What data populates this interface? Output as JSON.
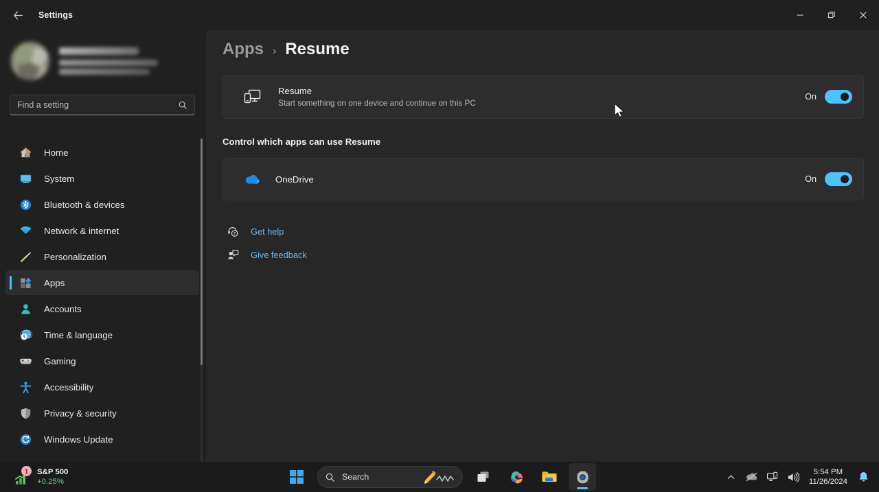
{
  "window": {
    "title": "Settings",
    "back_icon": "back-arrow-icon",
    "controls": {
      "minimize": "minimize-icon",
      "restore": "restore-icon",
      "close": "close-icon"
    }
  },
  "sidebar": {
    "account": {
      "name_redacted": "",
      "email_redacted": ""
    },
    "search": {
      "placeholder": "Find a setting",
      "value": "",
      "icon": "search-icon"
    },
    "items": [
      {
        "label": "Home",
        "icon": "home-icon",
        "active": false
      },
      {
        "label": "System",
        "icon": "system-icon",
        "active": false
      },
      {
        "label": "Bluetooth & devices",
        "icon": "bluetooth-icon",
        "active": false
      },
      {
        "label": "Network & internet",
        "icon": "wifi-icon",
        "active": false
      },
      {
        "label": "Personalization",
        "icon": "paintbrush-icon",
        "active": false
      },
      {
        "label": "Apps",
        "icon": "apps-icon",
        "active": true
      },
      {
        "label": "Accounts",
        "icon": "person-icon",
        "active": false
      },
      {
        "label": "Time & language",
        "icon": "clock-globe-icon",
        "active": false
      },
      {
        "label": "Gaming",
        "icon": "gamepad-icon",
        "active": false
      },
      {
        "label": "Accessibility",
        "icon": "accessibility-icon",
        "active": false
      },
      {
        "label": "Privacy & security",
        "icon": "shield-icon",
        "active": false
      },
      {
        "label": "Windows Update",
        "icon": "update-icon",
        "active": false
      }
    ]
  },
  "main": {
    "breadcrumb": {
      "parent": "Apps",
      "separator": "›",
      "current": "Resume"
    },
    "resume_card": {
      "icon": "phone-monitor-icon",
      "title": "Resume",
      "subtitle": "Start something on one device and continue on this PC",
      "toggle_label": "On",
      "toggle_state": "on"
    },
    "section_title": "Control which apps can use Resume",
    "apps": [
      {
        "name": "OneDrive",
        "icon": "onedrive-cloud-icon",
        "toggle_label": "On",
        "toggle_state": "on"
      }
    ],
    "links": [
      {
        "label": "Get help",
        "icon": "help-icon"
      },
      {
        "label": "Give feedback",
        "icon": "feedback-icon"
      }
    ]
  },
  "taskbar": {
    "widget": {
      "name": "S&P 500",
      "delta": "+0.25%",
      "badge": "1",
      "icon": "stocks-icon"
    },
    "start": {
      "icon": "windows-start-icon"
    },
    "search": {
      "placeholder": "Search",
      "icon": "search-icon",
      "doodle": "pencil-squiggle-icon"
    },
    "buttons": [
      {
        "name": "task-view",
        "icon": "task-view-icon",
        "active": false
      },
      {
        "name": "copilot",
        "icon": "copilot-icon",
        "active": false
      },
      {
        "name": "file-explorer",
        "icon": "folder-icon",
        "active": false
      },
      {
        "name": "settings",
        "icon": "gear-icon",
        "active": true
      }
    ],
    "tray": {
      "chevron": "chevron-up-icon",
      "onedrive": "onedrive-offline-icon",
      "network": "network-icon",
      "volume": "volume-icon",
      "time": "5:54 PM",
      "date": "11/26/2024",
      "notification": "bell-icon"
    }
  },
  "colors": {
    "accent": "#4cc2ff",
    "link": "#6fb3e8",
    "positive": "#6ccf72",
    "window_bg": "#202020",
    "content_bg": "#272727",
    "card_bg": "#2d2d2d"
  }
}
